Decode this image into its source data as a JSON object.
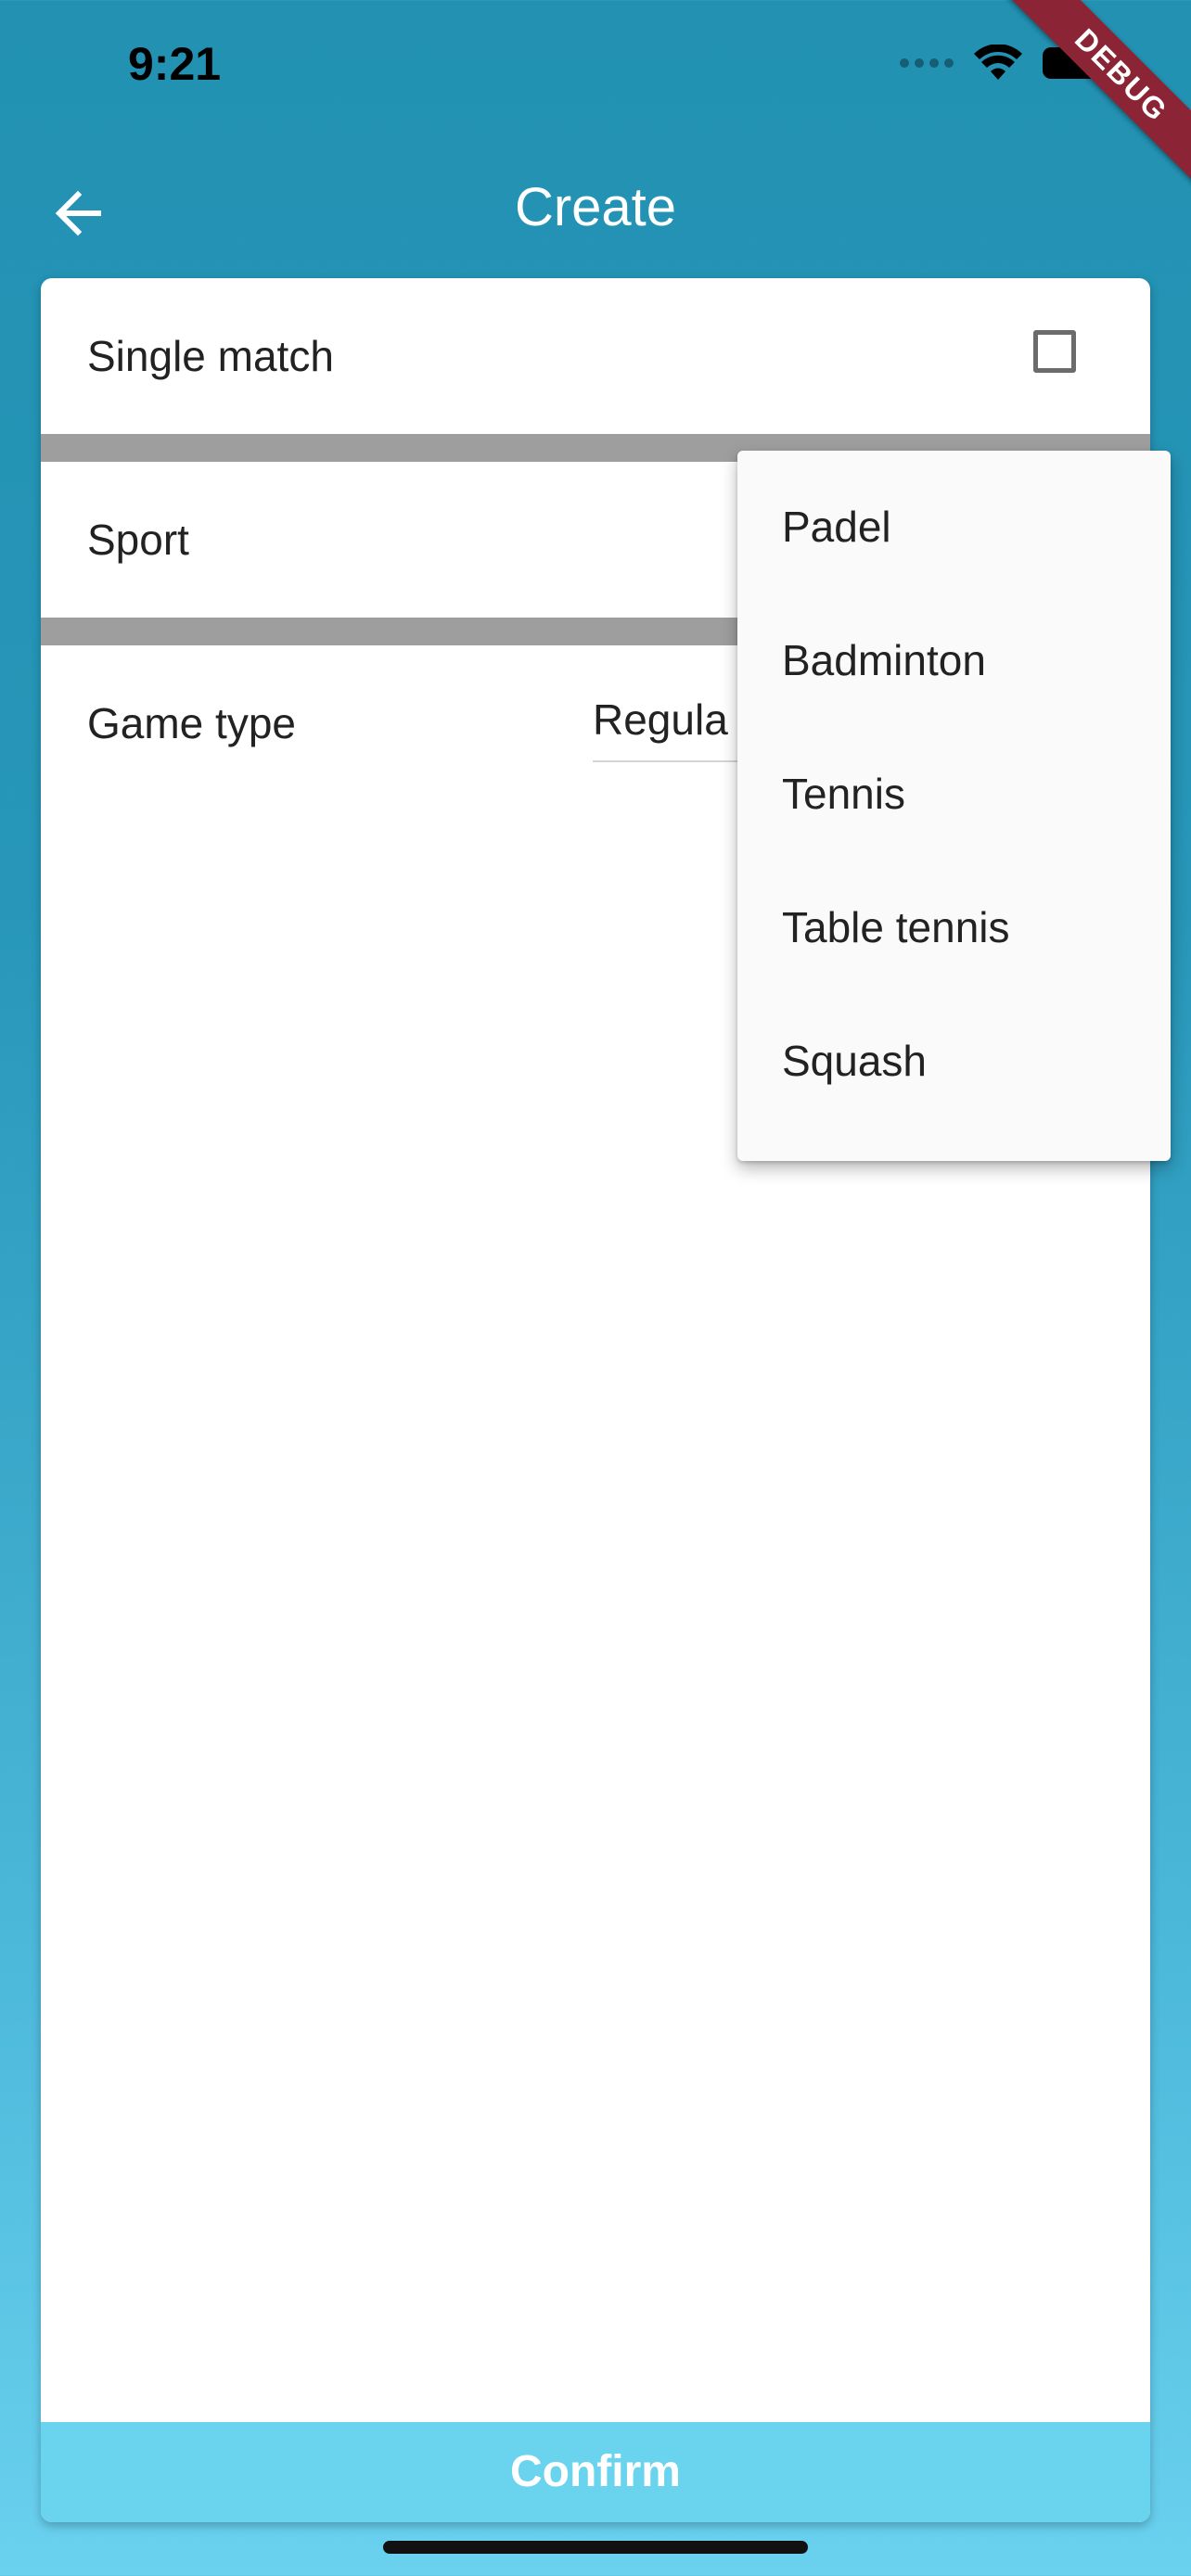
{
  "status_bar": {
    "time": "9:21"
  },
  "debug_banner": "DEBUG",
  "app_bar": {
    "title": "Create"
  },
  "form": {
    "single_match_label": "Single match",
    "sport_label": "Sport",
    "game_type_label": "Game type",
    "game_type_value": "Regula"
  },
  "dropdown": {
    "options": [
      "Padel",
      "Badminton",
      "Tennis",
      "Table tennis",
      "Squash"
    ]
  },
  "confirm_label": "Confirm",
  "colors": {
    "primary": "#2291B2",
    "confirm": "#6AD3EE",
    "divider": "#9E9E9E",
    "debug": "#8B2434"
  }
}
